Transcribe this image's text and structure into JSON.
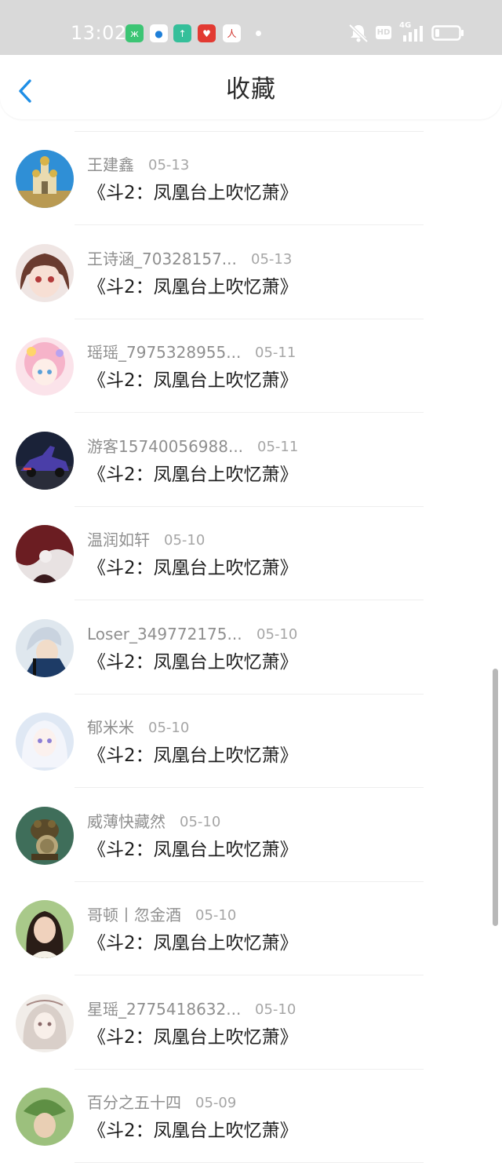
{
  "status_bar": {
    "time": "13:02",
    "network": "4G",
    "hd": "HD",
    "apps": [
      {
        "icon": "green-app-icon",
        "color": "#3cc574",
        "glyph": "ж"
      },
      {
        "icon": "blue-ring-app-icon",
        "color": "#ffffff",
        "glyph": "●"
      },
      {
        "icon": "teal-upload-app-icon",
        "color": "#35bf9a",
        "glyph": "↑"
      },
      {
        "icon": "red-heart-app-icon",
        "color": "#e23a32",
        "glyph": "♥"
      },
      {
        "icon": "people-daily-app-icon",
        "color": "#ffffff",
        "glyph": "人"
      }
    ]
  },
  "header": {
    "title": "收藏",
    "accent": "#1e8ee6"
  },
  "items": [
    {
      "name": "王建鑫",
      "date": "05-13",
      "title": "《斗2：凤凰台上吹忆萧》",
      "avatar": "cathedral-avatar"
    },
    {
      "name": "王诗涵_70328157...",
      "date": "05-13",
      "title": "《斗2：凤凰台上吹忆萧》",
      "avatar": "anime-girl-avatar"
    },
    {
      "name": "瑶瑶_7975328955...",
      "date": "05-11",
      "title": "《斗2：凤凰台上吹忆萧》",
      "avatar": "pink-anime-avatar"
    },
    {
      "name": "游客15740056988...",
      "date": "05-11",
      "title": "《斗2：凤凰台上吹忆萧》",
      "avatar": "sports-car-avatar"
    },
    {
      "name": "温润如轩",
      "date": "05-10",
      "title": "《斗2：凤凰台上吹忆萧》",
      "avatar": "dark-red-art-avatar"
    },
    {
      "name": "Loser_349772175...",
      "date": "05-10",
      "title": "《斗2：凤凰台上吹忆萧》",
      "avatar": "anime-boy-avatar"
    },
    {
      "name": "郁米米",
      "date": "05-10",
      "title": "《斗2：凤凰台上吹忆萧》",
      "avatar": "white-hair-anime-avatar"
    },
    {
      "name": "威薄快藏然",
      "date": "05-10",
      "title": "《斗2：凤凰台上吹忆萧》",
      "avatar": "frog-statue-avatar"
    },
    {
      "name": "哥顿丨忽金酒",
      "date": "05-10",
      "title": "《斗2：凤凰台上吹忆萧》",
      "avatar": "girl-portrait-avatar"
    },
    {
      "name": "星瑶_2775418632...",
      "date": "05-10",
      "title": "《斗2：凤凰台上吹忆萧》",
      "avatar": "sketch-girl-avatar"
    },
    {
      "name": "百分之五十四",
      "date": "05-09",
      "title": "《斗2：凤凰台上吹忆萧》",
      "avatar": "green-leaf-avatar"
    }
  ]
}
